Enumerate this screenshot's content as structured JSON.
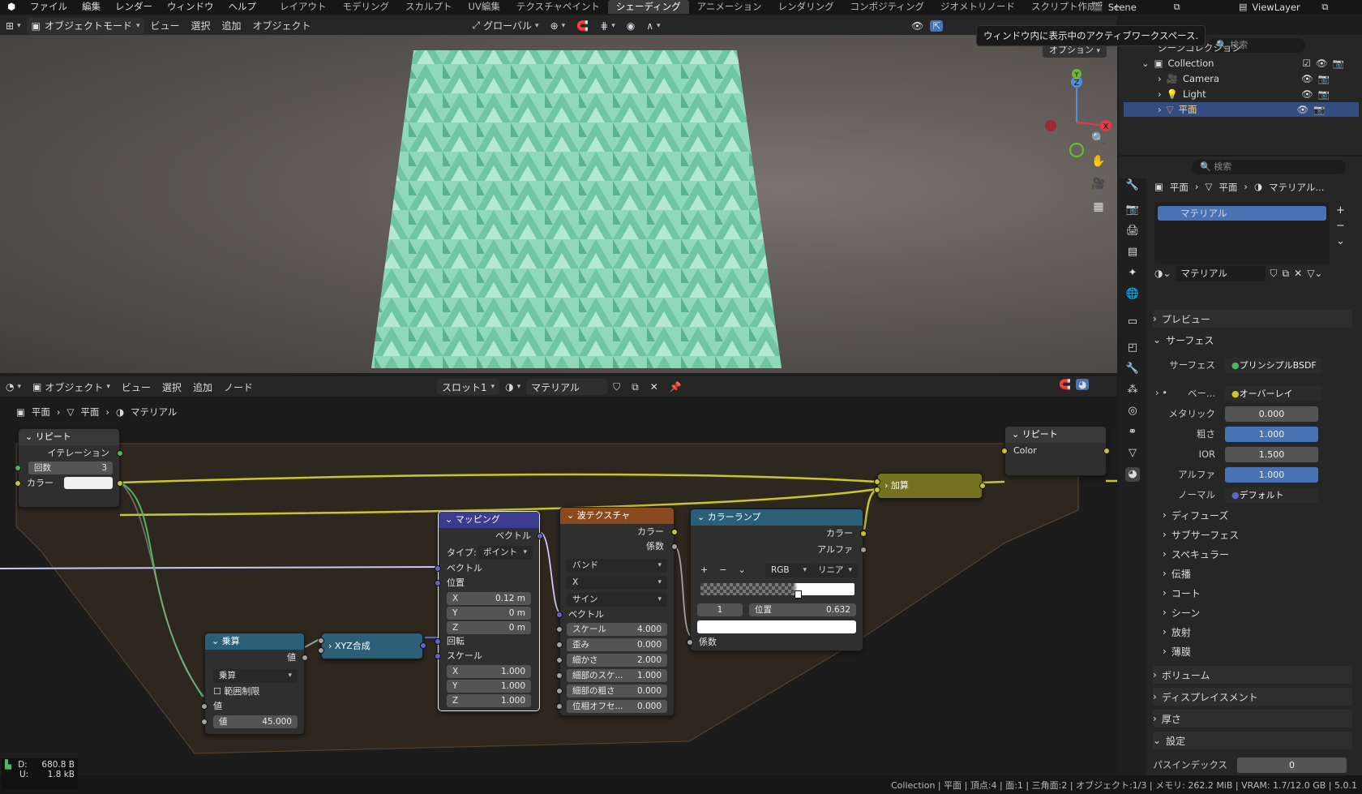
{
  "topbar": {
    "menus": [
      "ファイル",
      "編集",
      "レンダー",
      "ウィンドウ",
      "ヘルプ"
    ],
    "workspaces": [
      "レイアウト",
      "モデリング",
      "スカルプト",
      "UV編集",
      "テクスチャペイント",
      "シェーディング",
      "アニメーション",
      "レンダリング",
      "コンポジティング",
      "ジオメトリノード",
      "スクリプト作成"
    ],
    "active_workspace": "シェーディング",
    "add_tab": "+",
    "scene": "Scene",
    "viewlayer": "ViewLayer"
  },
  "tooltip": "ウィンドウ内に表示中のアクティブワークスペース.",
  "viewport_header": {
    "mode": "オブジェクトモード",
    "menus": [
      "ビュー",
      "選択",
      "追加",
      "オブジェクト"
    ],
    "transform": "グローバル",
    "options": "オプション"
  },
  "gizmo": {
    "x": "X",
    "y": "Y",
    "z": "Z"
  },
  "node_header": {
    "mode": "オブジェクト",
    "menus": [
      "ビュー",
      "選択",
      "追加",
      "ノード"
    ],
    "slot": "スロット1",
    "material": "マテリアル"
  },
  "breadcrumb": {
    "object": "平面",
    "mesh": "平面",
    "material": "マテリアル"
  },
  "nodes": {
    "repeat_in": {
      "title": "リピート",
      "iteration": "イテレーション",
      "count_label": "回数",
      "count": "3",
      "color_label": "カラー"
    },
    "multiply": {
      "title": "乗算",
      "output": "値",
      "op": "乗算",
      "clamp": "範囲制限",
      "value_in": "値",
      "value_label": "値",
      "value": "45.000"
    },
    "xyz": {
      "title": "XYZ合成"
    },
    "mapping": {
      "title": "マッピング",
      "out": "ベクトル",
      "type_label": "タイプ:",
      "type": "ポイント",
      "vector": "ベクトル",
      "location": "位置",
      "lx": "0.12 m",
      "ly": "0 m",
      "lz": "0 m",
      "rotation": "回転",
      "scale": "スケール",
      "sx": "1.000",
      "sy": "1.000",
      "sz": "1.000",
      "x": "X",
      "y": "Y",
      "z": "Z"
    },
    "wave": {
      "title": "波テクスチャ",
      "color": "カラー",
      "fac": "係数",
      "type": "バンド",
      "dir": "X",
      "profile": "サイン",
      "vector": "ベクトル",
      "scale_l": "スケール",
      "scale": "4.000",
      "distortion_l": "歪み",
      "distortion": "0.000",
      "detail_l": "細かさ",
      "detail": "2.000",
      "detail_scale_l": "細部のスケ...",
      "detail_scale": "1.000",
      "roughness_l": "細部の粗さ",
      "roughness": "0.000",
      "phase_l": "位相オフセ...",
      "phase": "0.000"
    },
    "ramp": {
      "title": "カラーランプ",
      "color": "カラー",
      "alpha": "アルファ",
      "mode": "RGB",
      "interp": "リニア",
      "stop_index": "1",
      "pos_label": "位置",
      "pos": "0.632",
      "fac": "係数",
      "add": "+",
      "remove": "−"
    },
    "add": {
      "title": "加算"
    },
    "repeat_out": {
      "title": "リピート",
      "color": "Color"
    }
  },
  "outliner": {
    "search_placeholder": "検索",
    "scene_collection": "シーンコレクション",
    "items": [
      {
        "name": "Collection"
      },
      {
        "name": "Camera"
      },
      {
        "name": "Light"
      },
      {
        "name": "平面"
      }
    ]
  },
  "properties": {
    "search_placeholder": "検索",
    "breadcrumb": [
      "平面",
      "平面",
      "マテリアル..."
    ],
    "slot": "マテリアル",
    "material_name": "マテリアル",
    "panels": {
      "preview": "プレビュー",
      "surface": "サーフェス"
    },
    "rows": [
      {
        "label": "サーフェス",
        "value": "プリンシプルBSDF"
      },
      {
        "label": "ベー...",
        "value": "オーバーレイ"
      },
      {
        "label": "メタリック",
        "value": "0.000"
      },
      {
        "label": "粗さ",
        "value": "1.000"
      },
      {
        "label": "IOR",
        "value": "1.500"
      },
      {
        "label": "アルファ",
        "value": "1.000"
      },
      {
        "label": "ノーマル",
        "value": "デフォルト"
      }
    ],
    "subpanels": [
      "ディフューズ",
      "サブサーフェス",
      "スペキュラー",
      "伝播",
      "コート",
      "シーン",
      "放射",
      "薄膜"
    ],
    "bottom_panels": [
      "ボリューム",
      "ディスプレイスメント",
      "厚さ",
      "設定"
    ],
    "pass_index_label": "パスインデックス",
    "pass_index": "0"
  },
  "overlay_stats": {
    "d_label": "D:",
    "d_value": "680.8 B",
    "u_label": "U:",
    "u_value": "1.8 kB"
  },
  "status": "Collection | 平面 | 頂点:4 | 面:1 | 三角面:2 | オブジェクト:1/3 | メモリ: 262.2 MiB | VRAM: 1.7/12.0 GB | 5.0.1",
  "colors": {
    "accent": "#4772b3",
    "shader_yellow": "#c7c729",
    "frame": "#3a2e22",
    "plane": "#8fd9b8"
  }
}
